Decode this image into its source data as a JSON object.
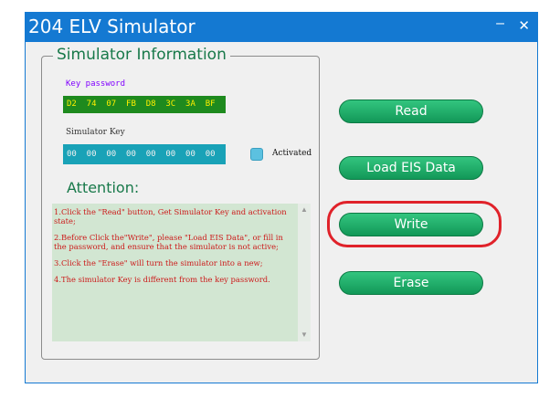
{
  "window": {
    "title": "204 ELV Simulator",
    "minimize_glyph": "–",
    "close_glyph": "✕"
  },
  "group": {
    "title": "Simulator Information"
  },
  "key_password": {
    "label": "Key password",
    "value": "D2  74  07  FB  D8  3C  3A  BF"
  },
  "simulator_key": {
    "label": "Simulator Key",
    "value": "00  00  00  00  00  00  00  00"
  },
  "activated": {
    "label": "Activated",
    "color": "#5cc1e0"
  },
  "attention": {
    "title": "Attention:",
    "notes": [
      "1.Click the \"Read\" button, Get Simulator Key and activation state;",
      "2.Before Click the\"Write\", please \"Load EIS Data\", or fill in the password, and ensure that the simulator is not active;",
      "3.Click the \"Erase\" will turn the simulator into a new;",
      "4.The simulator Key is different from the key password."
    ]
  },
  "buttons": {
    "read": "Read",
    "load": "Load EIS Data",
    "write": "Write",
    "erase": "Erase"
  },
  "colors": {
    "titlebar": "#1479d2",
    "accent_green": "#18794a",
    "highlight": "#e0222a"
  }
}
